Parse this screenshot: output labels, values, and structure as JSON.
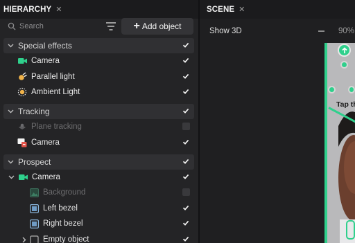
{
  "hierarchy": {
    "tab_label": "HIERARCHY",
    "tab_close": "✕",
    "search_placeholder": "Search",
    "add_object_label": "Add object",
    "add_object_plus": "+",
    "groups": [
      {
        "label": "Special effects",
        "items": [
          {
            "label": "Camera",
            "icon": "camera-icon",
            "checked": true
          },
          {
            "label": "Parallel light",
            "icon": "parallel-light-icon",
            "checked": true
          },
          {
            "label": "Ambient Light",
            "icon": "ambient-light-icon",
            "checked": true
          }
        ]
      },
      {
        "label": "Tracking",
        "items": [
          {
            "label": "Plane tracking",
            "icon": "plane-tracking-icon",
            "checked": false
          },
          {
            "label": "Camera",
            "icon": "camera-tracking-icon",
            "checked": true
          }
        ]
      },
      {
        "label": "Prospect",
        "items": [
          {
            "label": "Camera",
            "icon": "camera-icon",
            "checked": true
          },
          {
            "label": "Background",
            "icon": "image-icon",
            "checked": false
          },
          {
            "label": "Left bezel",
            "icon": "bezel-icon",
            "checked": true
          },
          {
            "label": "Right bezel",
            "icon": "bezel-icon",
            "checked": true
          },
          {
            "label": "Empty object",
            "icon": "object-icon",
            "checked": true
          }
        ]
      }
    ]
  },
  "scene": {
    "tab_label": "SCENE",
    "tab_close": "✕",
    "show_3d_label": "Show 3D",
    "zoom_level": "90%",
    "overlay_text": "Tap th"
  },
  "colors": {
    "accent_green": "#2fd08c",
    "panel_bg": "#242426",
    "header_bg": "#303033"
  }
}
